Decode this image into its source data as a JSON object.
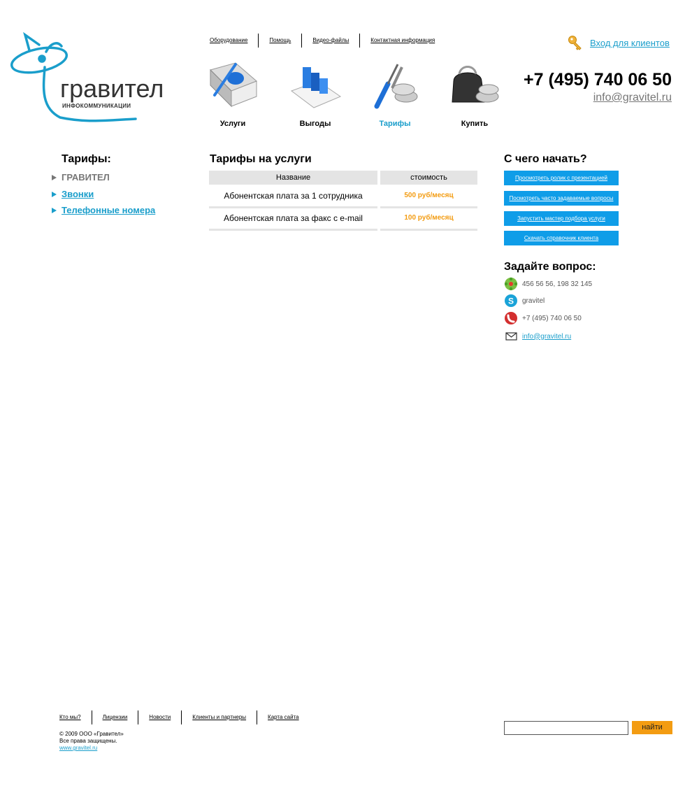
{
  "logo": {
    "word": "гравител",
    "sub": "ИНФОКОММУНИКАЦИИ"
  },
  "topnav": [
    "Оборудование",
    "Помощь",
    "Видео-файлы",
    "Контактная информация"
  ],
  "login": {
    "label": "Вход для клиентов",
    "icon": "key-icon"
  },
  "contacts_header": {
    "phone": "+7 (495) 740 06 50",
    "email": "info@gravitel.ru"
  },
  "bignav": [
    {
      "label": "Услуги",
      "icon": "book-icon",
      "active": false
    },
    {
      "label": "Выгоды",
      "icon": "bar-chart-icon",
      "active": false
    },
    {
      "label": "Тарифы",
      "icon": "tools-coins-icon",
      "active": true
    },
    {
      "label": "Купить",
      "icon": "purse-icon",
      "active": false
    }
  ],
  "sidebar": {
    "title": "Тарифы:",
    "items": [
      "ГРАВИТЕЛ",
      "Звонки",
      "Телефонные номера"
    ]
  },
  "main": {
    "title": "Тарифы на услуги",
    "columns": [
      "Название",
      "стоимость"
    ],
    "rows": [
      {
        "name": "Абонентская плата за 1 сотрудника",
        "price": "500 руб/месяц"
      },
      {
        "name": "Абонентская плата за факс с e-mail",
        "price": "100 руб/месяц"
      }
    ]
  },
  "right": {
    "start_title": "С чего начать?",
    "buttons": [
      "Просмотреть ролик с презентацией",
      "Посмотреть часто задаваемые вопросы",
      "Запустить мастер подбора услуги",
      "Скачать справочник клиента"
    ],
    "ask_title": "Задайте вопрос:",
    "contacts": [
      {
        "icon": "icq-icon",
        "text": "456 56 56, 198 32 145"
      },
      {
        "icon": "skype-icon",
        "text": "gravitel"
      },
      {
        "icon": "phone-icon",
        "text": "+7 (495) 740 06 50"
      },
      {
        "icon": "mail-icon",
        "text": "info@gravitel.ru"
      }
    ]
  },
  "footer": {
    "nav": [
      "Кто мы?",
      "Лицензии",
      "Новости",
      "Клиенты и партнеры",
      "Карта сайта"
    ],
    "copyright": "© 2009 ООО «Гравител»",
    "rights": "Все права защищены.",
    "site": "www.gravitel.ru",
    "search_value": "",
    "search_button": "найти"
  },
  "colors": {
    "accent": "#1a9ecb",
    "button_blue": "#0f9de8",
    "price_orange": "#f39c12",
    "header_gray": "#e4e4e4"
  }
}
